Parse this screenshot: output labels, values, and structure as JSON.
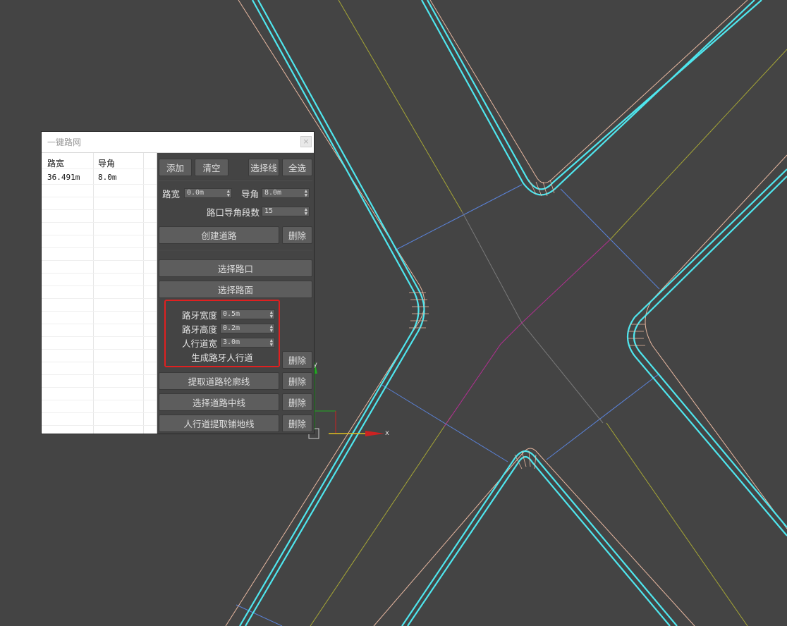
{
  "panel": {
    "title": "一键路网",
    "close_label": "×"
  },
  "list": {
    "headers": [
      "路宽",
      "导角"
    ],
    "rows": [
      [
        "36.491m",
        "8.0m"
      ]
    ]
  },
  "toolbar": {
    "add_label": "添加",
    "clear_label": "清空",
    "select_line_label": "选择线",
    "select_all_label": "全选"
  },
  "params": {
    "road_width_label": "路宽",
    "road_width_value": "0.0m",
    "chamfer_label": "导角",
    "chamfer_value": "8.0m",
    "segments_label": "路口导角段数",
    "segments_value": "15"
  },
  "actions": {
    "create_road_label": "创建道路",
    "delete_label": "删除",
    "select_intersection_label": "选择路口",
    "select_surface_label": "选择路面",
    "extract_outline_label": "提取道路轮廓线",
    "select_centerline_label": "选择道路中线",
    "extract_paving_label": "人行道提取铺地线"
  },
  "curb": {
    "curb_width_label": "路牙宽度",
    "curb_width_value": "0.5m",
    "curb_height_label": "路牙高度",
    "curb_height_value": "0.2m",
    "sidewalk_width_label": "人行道宽",
    "sidewalk_width_value": "3.0m",
    "generate_label": "生成路牙人行道"
  },
  "gizmo": {
    "x_label": "x",
    "y_label": "y"
  },
  "colors": {
    "viewport_bg": "#444444",
    "road_outline": "#4fe6ee",
    "offset_line": "#e8b8a0",
    "center_line": "#a8a830",
    "section_line": "#4f7fd8",
    "diagonal_line": "#b03090",
    "highlight_box": "#e02020"
  }
}
